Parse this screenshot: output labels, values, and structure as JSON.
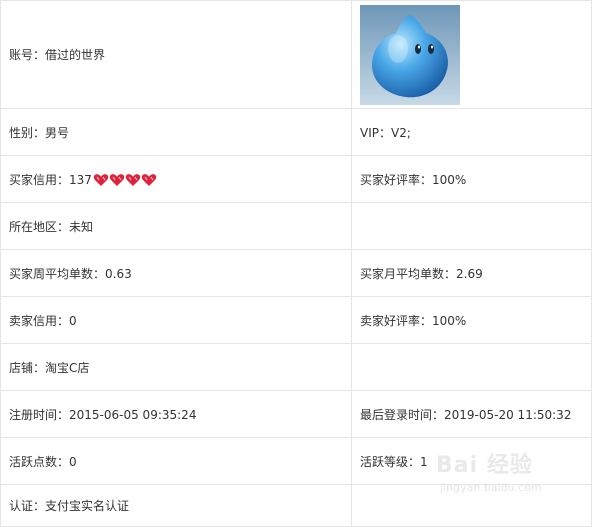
{
  "rows": [
    {
      "left": "账号：借过的世界",
      "right_type": "avatar",
      "avatar_icon": "qq-penguin-blob-icon"
    },
    {
      "left": "性别：男号",
      "right": "VIP：V2;"
    },
    {
      "left": "买家信用：137",
      "left_icons": [
        "heart-icon",
        "heart-icon",
        "heart-icon",
        "heart-icon"
      ],
      "right": "买家好评率：100%"
    },
    {
      "left": "所在地区：未知",
      "right": ""
    },
    {
      "left": "买家周平均单数：0.63",
      "right": "买家月平均单数：2.69"
    },
    {
      "left": "卖家信用：0",
      "right": "卖家好评率：100%"
    },
    {
      "left": "店铺：淘宝C店",
      "right": ""
    },
    {
      "left": "注册时间：2015-06-05 09:35:24",
      "right": "最后登录时间：2019-05-20 11:50:32"
    },
    {
      "left": "活跃点数：0",
      "right": "活跃等级：1"
    },
    {
      "left": "认证：支付宝实名认证",
      "right": ""
    }
  ],
  "watermark": {
    "title": "Bai 经验",
    "url": "jingyan.baidu.com"
  },
  "colors": {
    "heart": "#e0223a",
    "avatar": "#3a93d8",
    "border": "#e6e6e6"
  }
}
